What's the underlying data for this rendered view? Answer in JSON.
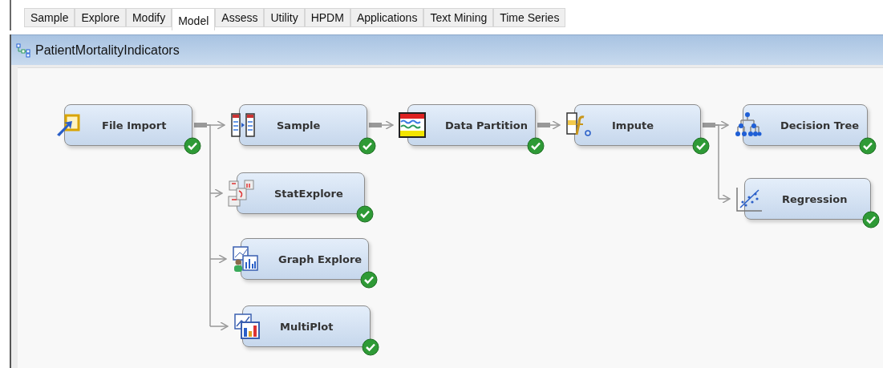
{
  "tabs": [
    {
      "label": "Sample",
      "selected": false
    },
    {
      "label": "Explore",
      "selected": false
    },
    {
      "label": "Modify",
      "selected": false
    },
    {
      "label": "Model",
      "selected": true
    },
    {
      "label": "Assess",
      "selected": false
    },
    {
      "label": "Utility",
      "selected": false
    },
    {
      "label": "HPDM",
      "selected": false
    },
    {
      "label": "Applications",
      "selected": false
    },
    {
      "label": "Text Mining",
      "selected": false
    },
    {
      "label": "Time Series",
      "selected": false
    }
  ],
  "diagram": {
    "title": "PatientMortalityIndicators",
    "nodes": [
      {
        "label": "File Import",
        "kind": "file-import",
        "completed": true
      },
      {
        "label": "Sample",
        "kind": "sample",
        "completed": true
      },
      {
        "label": "Data Partition",
        "kind": "data-partition",
        "completed": true
      },
      {
        "label": "Impute",
        "kind": "impute",
        "completed": true
      },
      {
        "label": "Decision Tree",
        "kind": "decision-tree",
        "completed": true
      },
      {
        "label": "StatExplore",
        "kind": "stat-explore",
        "completed": true
      },
      {
        "label": "Graph Explore",
        "kind": "graph-explore",
        "completed": true
      },
      {
        "label": "MultiPlot",
        "kind": "multiplot",
        "completed": true
      },
      {
        "label": "Regression",
        "kind": "regression",
        "completed": true
      }
    ]
  }
}
